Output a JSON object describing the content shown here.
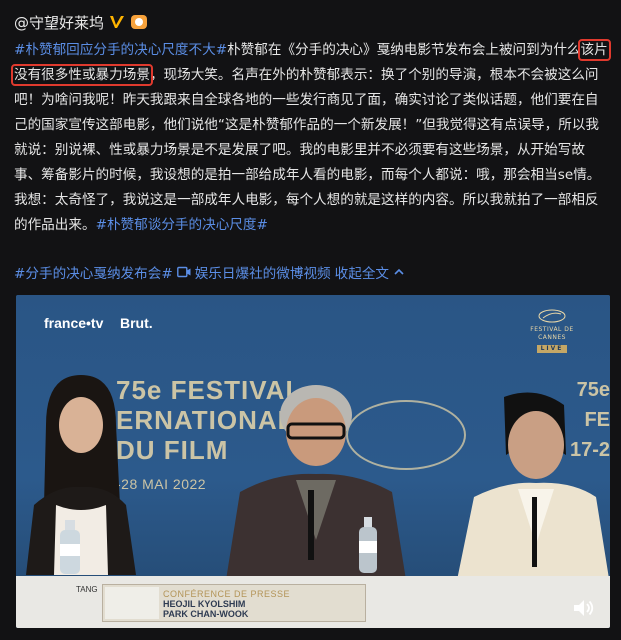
{
  "header": {
    "username": "@守望好莱坞",
    "verified_icon": "verified-v-icon",
    "badge_icon": "fan-badge-icon"
  },
  "post": {
    "line1_hashtag": "#朴赞郁回应分手的决心尺度不大#",
    "line1_rest": "朴赞郁在《分手的决心》戛纳电影节发布会上被问到为什么",
    "line2_highlight": "该片没有很多性或暴力场景",
    "line2_rest": "，现场大笑。名声在外的朴赞郁表示：换了个别的导演，根本不会被这么问吧！为啥问我呢！昨天我跟来自全球各地的一些发行商见了面，确实讨论了类似话题，他们要在自己的国家宣传这部电影，他们说他“这是朴赞郁作品的一个新发展！”但我觉得这有点误导，所以我就说：别说裸、性或暴力场景是不是发展了吧。我的电影里并不必须要有这些场景，从开始写故事、筹备影片的时候，我设想的是拍一部给成年人看的电影，而每个人都说：哦，那会相当se情。我想：太奇怪了，我说这是一部成年人电影，每个人想的就是这样的内容。所以我就拍了一部相反的作品出来。",
    "end_hashtag": "#朴赞郁谈分手的决心尺度#"
  },
  "meta": {
    "topic_link": "#分手的决心戛纳发布会#",
    "video_source": "娱乐日爆社的微博视频",
    "collapse_label": "收起全文",
    "collapse_icon": "chevron-up-icon"
  },
  "video": {
    "brand_left": "france•tv",
    "brand_right": "Brut.",
    "logo_text_1": "FESTIVAL DE CANNES",
    "logo_live": "LIVE",
    "festival_line1": "75e FESTIVAL",
    "festival_line2": "ERNATIONAL",
    "festival_line3": "DU FILM",
    "festival_date": "-28 MAI 2022",
    "festival_right_top": "75e",
    "festival_right_mid": "FE",
    "festival_right_bot": "17-2",
    "nameplate_title": "CONFÉRENCE DE PRESSE",
    "nameplate_name1": "HEOJIL KYOLSHIM",
    "nameplate_name2": "PARK CHAN-WOOK",
    "card_left": "TANG",
    "mute_icon": "speaker-mute-icon"
  },
  "colors": {
    "hashtag": "#5b8ee6",
    "highlight_border": "#e03a2e",
    "background": "#121214"
  }
}
